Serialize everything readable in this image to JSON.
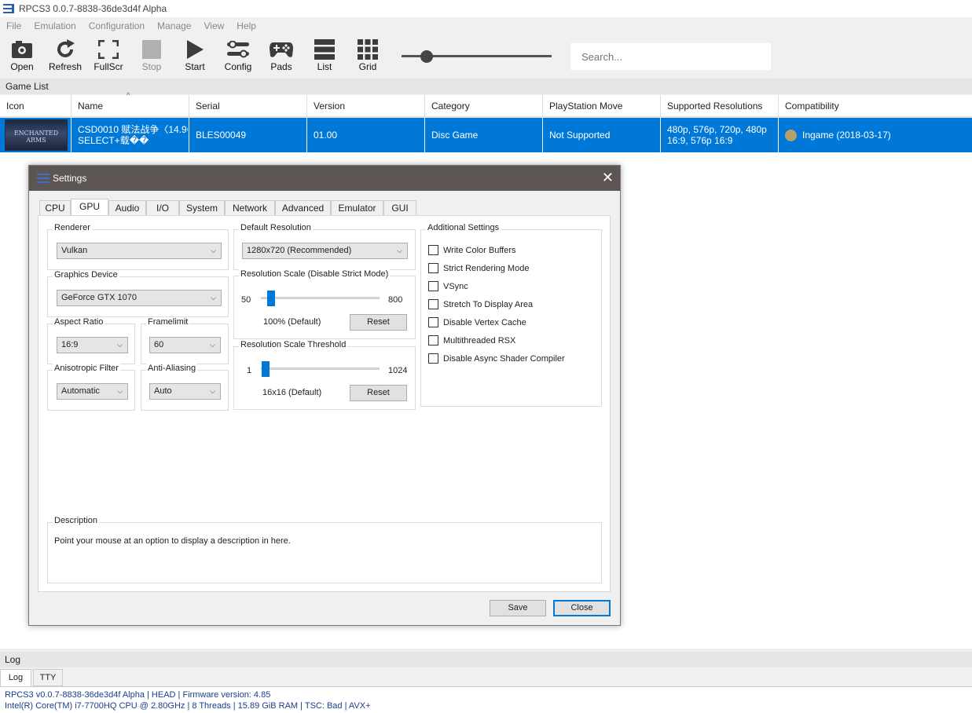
{
  "window": {
    "title": "RPCS3 0.0.7-8838-36de3d4f Alpha",
    "icon": "rpcs3-logo-icon"
  },
  "menu": [
    "File",
    "Emulation",
    "Configuration",
    "Manage",
    "View",
    "Help"
  ],
  "toolbar": {
    "buttons": [
      {
        "label": "Open",
        "icon": "open-icon"
      },
      {
        "label": "Refresh",
        "icon": "refresh-icon"
      },
      {
        "label": "FullScr",
        "icon": "fullscreen-icon"
      },
      {
        "label": "Stop",
        "icon": "stop-icon",
        "disabled": true
      },
      {
        "label": "Start",
        "icon": "play-icon"
      },
      {
        "label": "Config",
        "icon": "config-icon"
      },
      {
        "label": "Pads",
        "icon": "gamepad-icon"
      },
      {
        "label": "List",
        "icon": "list-icon"
      },
      {
        "label": "Grid",
        "icon": "grid-icon"
      }
    ],
    "zoom_slider_value": 0.15,
    "search_placeholder": "Search..."
  },
  "gamelist": {
    "label": "Game List",
    "columns": [
      "Icon",
      "Name",
      "Serial",
      "Version",
      "Category",
      "PlayStation Move",
      "Supported Resolutions",
      "Compatibility"
    ],
    "rows": [
      {
        "icon_text": "ENCHANTED ARMS",
        "name_line1": "CSD0010 赋法战争〈14.9G",
        "name_line2": "SELECT+载��",
        "serial": "BLES00049",
        "version": "01.00",
        "category": "Disc Game",
        "move": "Not Supported",
        "res_line1": "480p, 576p, 720p, 480p",
        "res_line2": "16:9, 576p 16:9",
        "compat": "Ingame (2018-03-17)",
        "compat_color": "#b5a06b"
      }
    ]
  },
  "settings": {
    "title": "Settings",
    "close": "✕",
    "tabs": [
      "CPU",
      "GPU",
      "Audio",
      "I/O",
      "System",
      "Network",
      "Advanced",
      "Emulator",
      "GUI"
    ],
    "active_tab": "GPU",
    "renderer": {
      "label": "Renderer",
      "value": "Vulkan"
    },
    "graphics_device": {
      "label": "Graphics Device",
      "value": "GeForce GTX 1070"
    },
    "aspect_ratio": {
      "label": "Aspect Ratio",
      "value": "16:9"
    },
    "framelimit": {
      "label": "Framelimit",
      "value": "60"
    },
    "anisotropic": {
      "label": "Anisotropic Filter",
      "value": "Automatic"
    },
    "antialiasing": {
      "label": "Anti-Aliasing",
      "value": "Auto"
    },
    "default_resolution": {
      "label": "Default Resolution",
      "value": "1280x720 (Recommended)"
    },
    "res_scale": {
      "label": "Resolution Scale (Disable Strict Mode)",
      "min": "50",
      "max": "800",
      "value_text": "100% (Default)",
      "value": 100,
      "reset": "Reset"
    },
    "res_threshold": {
      "label": "Resolution Scale Threshold",
      "min": "1",
      "max": "1024",
      "value_text": "16x16 (Default)",
      "value": 16,
      "reset": "Reset"
    },
    "additional": {
      "label": "Additional Settings",
      "items": [
        {
          "label": "Write Color Buffers",
          "checked": false
        },
        {
          "label": "Strict Rendering Mode",
          "checked": false
        },
        {
          "label": "VSync",
          "checked": false
        },
        {
          "label": "Stretch To Display Area",
          "checked": false
        },
        {
          "label": "Disable Vertex Cache",
          "checked": false
        },
        {
          "label": "Multithreaded RSX",
          "checked": false
        },
        {
          "label": "Disable Async Shader Compiler",
          "checked": false
        }
      ]
    },
    "description": {
      "label": "Description",
      "text": "Point your mouse at an option to display a description in here."
    },
    "save": "Save",
    "close_button": "Close"
  },
  "log": {
    "label": "Log",
    "tabs": [
      "Log",
      "TTY"
    ],
    "lines": [
      "RPCS3 v0.0.7-8838-36de3d4f Alpha | HEAD | Firmware version: 4.85",
      "Intel(R) Core(TM) i7-7700HQ CPU @ 2.80GHz | 8 Threads | 15.89 GiB RAM | TSC: Bad | AVX+"
    ]
  },
  "colors": {
    "accent": "#0078d7",
    "dialog_title": "#5c5551"
  }
}
